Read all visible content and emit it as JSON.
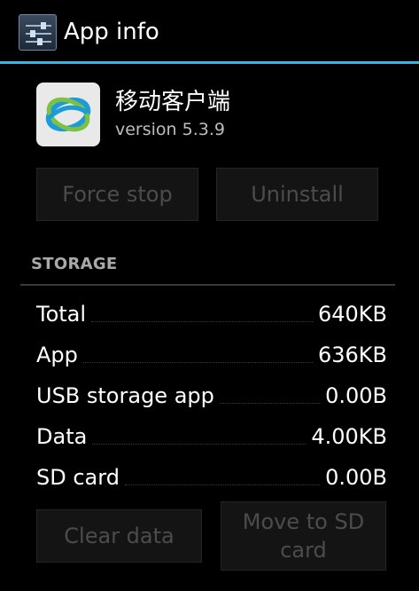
{
  "action_bar": {
    "title": "App info",
    "icon": "settings-sliders-icon"
  },
  "app": {
    "name": "移动客户端",
    "version": "version 5.3.9",
    "icon": "china-mobile-logo-icon"
  },
  "buttons": {
    "force_stop": "Force stop",
    "uninstall": "Uninstall",
    "clear_data": "Clear data",
    "move_to_sd": "Move to SD card"
  },
  "storage": {
    "header": "STORAGE",
    "rows": [
      {
        "label": "Total",
        "value": "640KB"
      },
      {
        "label": "App",
        "value": "636KB"
      },
      {
        "label": "USB storage app",
        "value": "0.00B"
      },
      {
        "label": "Data",
        "value": "4.00KB"
      },
      {
        "label": "SD card",
        "value": "0.00B"
      }
    ]
  },
  "colors": {
    "accent": "#33b5e5",
    "disabled_text": "#4c4c4c",
    "background": "#000000"
  }
}
